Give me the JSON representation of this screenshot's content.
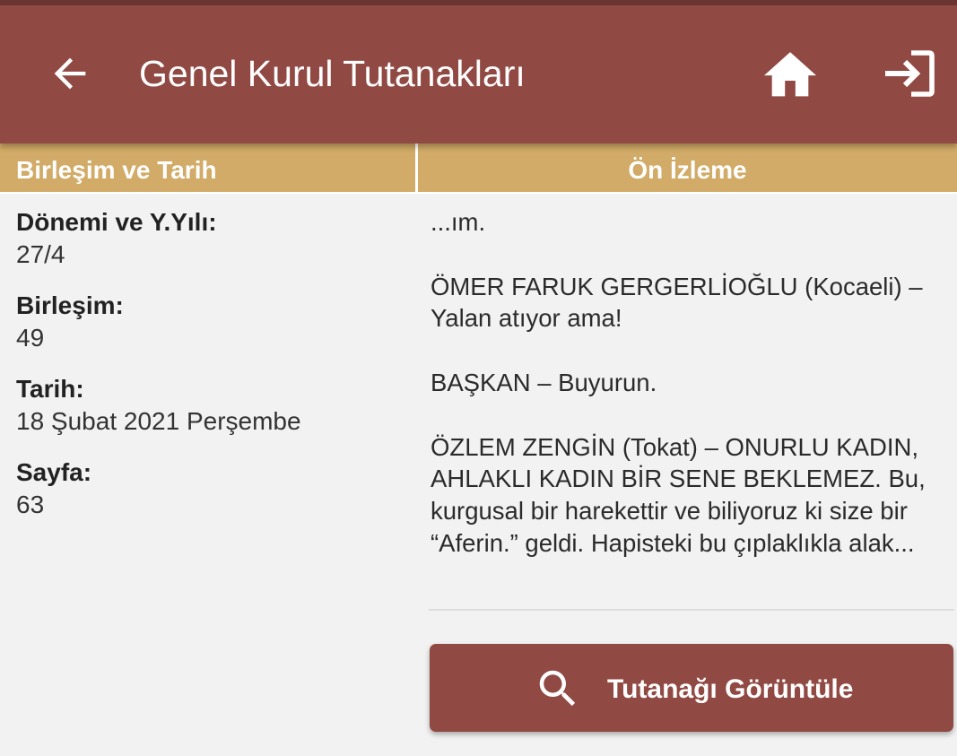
{
  "header": {
    "title": "Genel Kurul Tutanakları",
    "back_icon": "arrow-back-icon",
    "home_icon": "home-icon",
    "login_icon": "login-icon",
    "background_color": "#904943"
  },
  "columns": {
    "left_title": "Birleşim ve Tarih",
    "right_title": "Ön İzleme",
    "header_color": "#d1ab67"
  },
  "details": {
    "donem_label": "Dönemi ve Y.Yılı:",
    "donem_value": "27/4",
    "birlesim_label": "Birleşim:",
    "birlesim_value": "49",
    "tarih_label": "Tarih:",
    "tarih_value": "18 Şubat 2021 Perşembe",
    "sayfa_label": "Sayfa:",
    "sayfa_value": "63"
  },
  "preview": {
    "paragraphs": [
      "...ım.",
      "ÖMER FARUK GERGERLİOĞLU (Kocaeli) – Yalan atıyor ama!",
      "BAŞKAN – Buyurun.",
      "ÖZLEM ZENGİN (Tokat) – ONURLU KADIN, AHLAKLI KADIN BİR SENE BEKLEMEZ. Bu, kurgusal bir harekettir ve biliyoruz ki size bir “Aferin.” geldi. Hapisteki bu çıplaklıkla alak..."
    ]
  },
  "actions": {
    "view_label": "Tutanağı Görüntüle",
    "view_icon": "search-icon"
  }
}
